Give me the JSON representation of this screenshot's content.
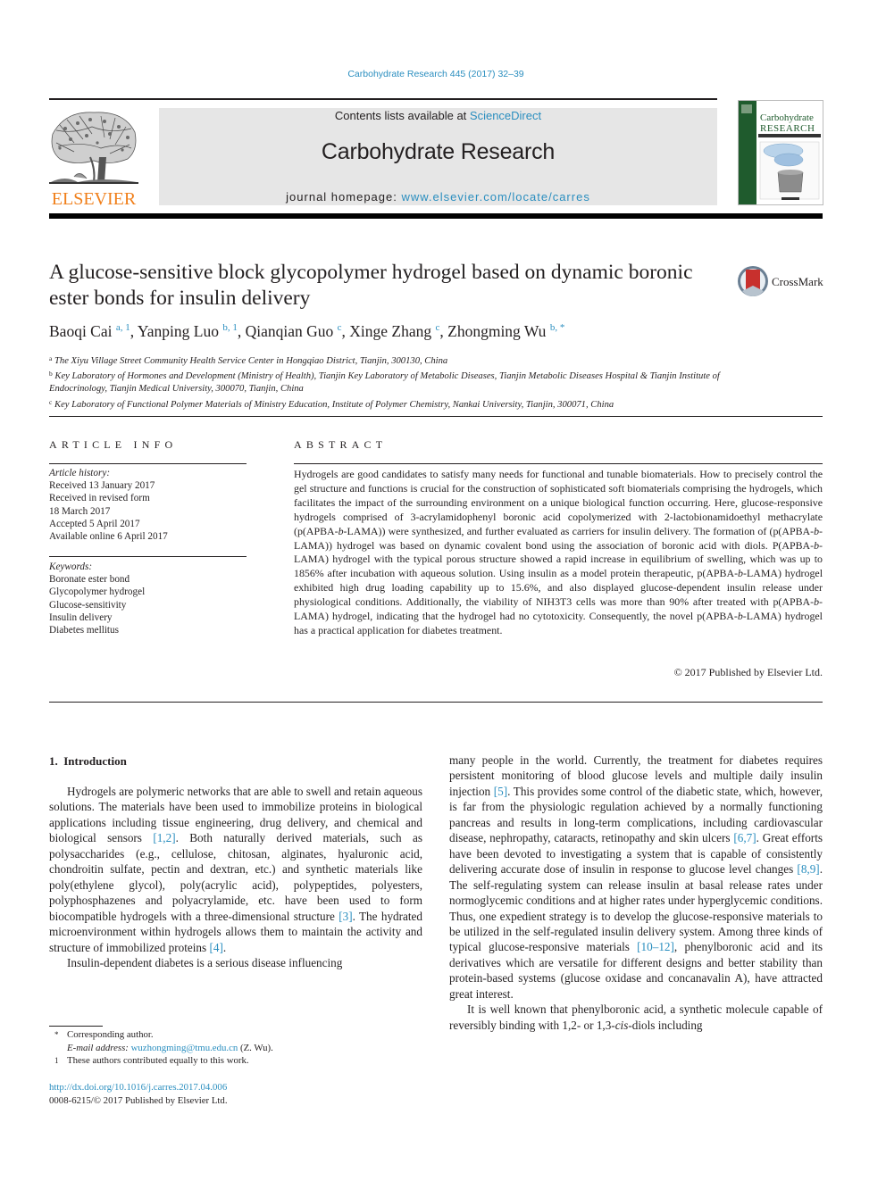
{
  "journal_citation": "Carbohydrate Research 445 (2017) 32–39",
  "header": {
    "publisher_logo_text": "ELSEVIER",
    "contents_prefix": "Contents lists available at ",
    "contents_link": "ScienceDirect",
    "journal_name": "Carbohydrate Research",
    "homepage_prefix": "journal homepage: ",
    "homepage_link": "www.elsevier.com/locate/carres",
    "cover": {
      "title_line1": "Carbohydrate",
      "title_line2": "RESEARCH"
    }
  },
  "article": {
    "title": "A glucose-sensitive block glycopolymer hydrogel based on dynamic boronic ester bonds for insulin delivery",
    "crossmark_label": "CrossMark",
    "authors": [
      {
        "name": "Baoqi Cai",
        "sup": "a, 1"
      },
      {
        "name": "Yanping Luo",
        "sup": "b, 1"
      },
      {
        "name": "Qianqian Guo",
        "sup": "c"
      },
      {
        "name": "Xinge Zhang",
        "sup": "c"
      },
      {
        "name": "Zhongming Wu",
        "sup": "b, *"
      }
    ],
    "affiliations": [
      {
        "mark": "a",
        "text": "The Xiyu Village Street Community Health Service Center in Hongqiao District, Tianjin, 300130, China"
      },
      {
        "mark": "b",
        "text": "Key Laboratory of Hormones and Development (Ministry of Health), Tianjin Key Laboratory of Metabolic Diseases, Tianjin Metabolic Diseases Hospital & Tianjin Institute of Endocrinology, Tianjin Medical University, 300070, Tianjin, China"
      },
      {
        "mark": "c",
        "text": "Key Laboratory of Functional Polymer Materials of Ministry Education, Institute of Polymer Chemistry, Nankai University, Tianjin, 300071, China"
      }
    ]
  },
  "article_info": {
    "heading": "ARTICLE INFO",
    "history_label": "Article history:",
    "history": [
      "Received 13 January 2017",
      "Received in revised form",
      "18 March 2017",
      "Accepted 5 April 2017",
      "Available online 6 April 2017"
    ],
    "keywords_label": "Keywords:",
    "keywords": [
      "Boronate ester bond",
      "Glycopolymer hydrogel",
      "Glucose-sensitivity",
      "Insulin delivery",
      "Diabetes mellitus"
    ]
  },
  "abstract": {
    "heading": "ABSTRACT",
    "text": "Hydrogels are good candidates to satisfy many needs for functional and tunable biomaterials. How to precisely control the gel structure and functions is crucial for the construction of sophisticated soft biomaterials comprising the hydrogels, which facilitates the impact of the surrounding environment on a unique biological function occurring. Here, glucose-responsive hydrogels comprised of 3-acrylamidophenyl boronic acid copolymerized with 2-lactobionamidoethyl methacrylate (p(APBA-b-LAMA)) were synthesized, and further evaluated as carriers for insulin delivery. The formation of (p(APBA-b-LAMA)) hydrogel was based on dynamic covalent bond using the association of boronic acid with diols. P(APBA-b-LAMA) hydrogel with the typical porous structure showed a rapid increase in equilibrium of swelling, which was up to 1856% after incubation with aqueous solution. Using insulin as a model protein therapeutic, p(APBA-b-LAMA) hydrogel exhibited high drug loading capability up to 15.6%, and also displayed glucose-dependent insulin release under physiological conditions. Additionally, the viability of NIH3T3 cells was more than 90% after treated with p(APBA-b-LAMA) hydrogel, indicating that the hydrogel had no cytotoxicity. Consequently, the novel p(APBA-b-LAMA) hydrogel has a practical application for diabetes treatment.",
    "copyright": "© 2017 Published by Elsevier Ltd."
  },
  "introduction": {
    "heading": "1.  Introduction",
    "left_paragraphs": [
      [
        "Hydrogels are polymeric networks that are able to swell and retain aqueous solutions. The materials have been used to immobilize proteins in biological applications including tissue engineering, drug delivery, and chemical and biological sensors ",
        "[1,2]",
        ". Both naturally derived materials, such as polysaccharides (e.g., cellulose, chitosan, alginates, hyaluronic acid, chondroitin sulfate, pectin and dextran, etc.) and synthetic materials like poly(ethylene glycol), poly(acrylic acid), polypeptides, polyesters, polyphosphazenes and polyacrylamide, etc. have been used to form biocompatible hydrogels with a three-dimensional structure ",
        "[3]",
        ". The hydrated microenvironment within hydrogels allows them to maintain the activity and structure of immobilized proteins ",
        "[4]",
        "."
      ],
      [
        "Insulin-dependent diabetes is a serious disease influencing"
      ]
    ],
    "right_paragraphs": [
      [
        "many people in the world. Currently, the treatment for diabetes requires persistent monitoring of blood glucose levels and multiple daily insulin injection ",
        "[5]",
        ". This provides some control of the diabetic state, which, however, is far from the physiologic regulation achieved by a normally functioning pancreas and results in long-term complications, including cardiovascular disease, nephropathy, cataracts, retinopathy and skin ulcers ",
        "[6,7]",
        ". Great efforts have been devoted to investigating a system that is capable of consistently delivering accurate dose of insulin in response to glucose level changes ",
        "[8,9]",
        ". The self-regulating system can release insulin at basal release rates under normoglycemic conditions and at higher rates under hyperglycemic conditions. Thus, one expedient strategy is to develop the glucose-responsive materials to be utilized in the self-regulated insulin delivery system. Among three kinds of typical glucose-responsive materials ",
        "[10–12]",
        ", phenylboronic acid and its derivatives which are versatile for different designs and better stability than protein-based systems (glucose oxidase and concanavalin A), have attracted great interest."
      ],
      [
        "It is well known that phenylboronic acid, a synthetic molecule capable of reversibly binding with 1,2- or 1,3-",
        "cis",
        "-diols including"
      ]
    ]
  },
  "footnotes": {
    "corresponding_mark": "*",
    "corresponding_text": "Corresponding author.",
    "email_label": "E-mail address: ",
    "email": "wuzhongming@tmu.edu.cn",
    "email_suffix": " (Z. Wu).",
    "equal_mark": "1",
    "equal_text": "These authors contributed equally to this work.",
    "doi": "http://dx.doi.org/10.1016/j.carres.2017.04.006",
    "issn_line": "0008-6215/© 2017 Published by Elsevier Ltd."
  },
  "colors": {
    "link": "#2a8ebf",
    "elsevier_orange": "#f07f1a",
    "cover_green": "#1f5b2d",
    "crossmark_red": "#c8302d"
  }
}
